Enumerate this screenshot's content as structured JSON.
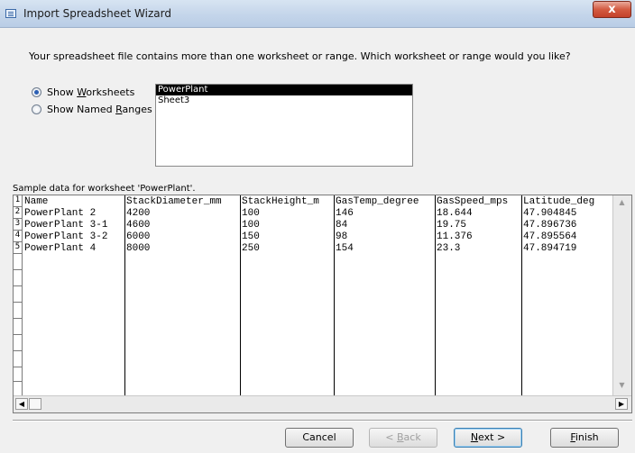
{
  "window": {
    "title": "Import Spreadsheet Wizard",
    "close_glyph": "x"
  },
  "prompt": "Your spreadsheet file contains more than one worksheet or range. Which worksheet or range would you like?",
  "options": {
    "worksheets": {
      "pre": "Show ",
      "accel": "W",
      "post": "orksheets",
      "checked": true
    },
    "ranges": {
      "pre": "Show Named ",
      "accel": "R",
      "post": "anges",
      "checked": false
    }
  },
  "sheets": [
    "PowerPlant",
    "Sheet3"
  ],
  "selected_sheet": "PowerPlant",
  "sample_label": "Sample data for worksheet 'PowerPlant'.",
  "table": {
    "row_numbers": [
      "1",
      "2",
      "3",
      "4",
      "5"
    ],
    "headers": [
      "Name",
      "StackDiameter_mm",
      "StackHeight_m",
      "GasTemp_degree",
      "GasSpeed_mps",
      "Latitude_deg"
    ],
    "rows": [
      [
        "PowerPlant 2",
        "4200",
        "100",
        "146",
        "18.644",
        "47.904845"
      ],
      [
        "PowerPlant 3-1",
        "4600",
        "100",
        "84",
        "19.75",
        "47.896736"
      ],
      [
        "PowerPlant 3-2",
        "6000",
        "150",
        "98",
        "11.376",
        "47.895564"
      ],
      [
        "PowerPlant 4",
        "8000",
        "250",
        "154",
        "23.3",
        "47.894719"
      ]
    ]
  },
  "buttons": {
    "cancel": {
      "label": "Cancel"
    },
    "back": {
      "pre": "< ",
      "accel": "B",
      "post": "ack"
    },
    "next": {
      "pre": "",
      "accel": "N",
      "post": "ext >"
    },
    "finish": {
      "pre": "",
      "accel": "F",
      "post": "inish"
    }
  }
}
